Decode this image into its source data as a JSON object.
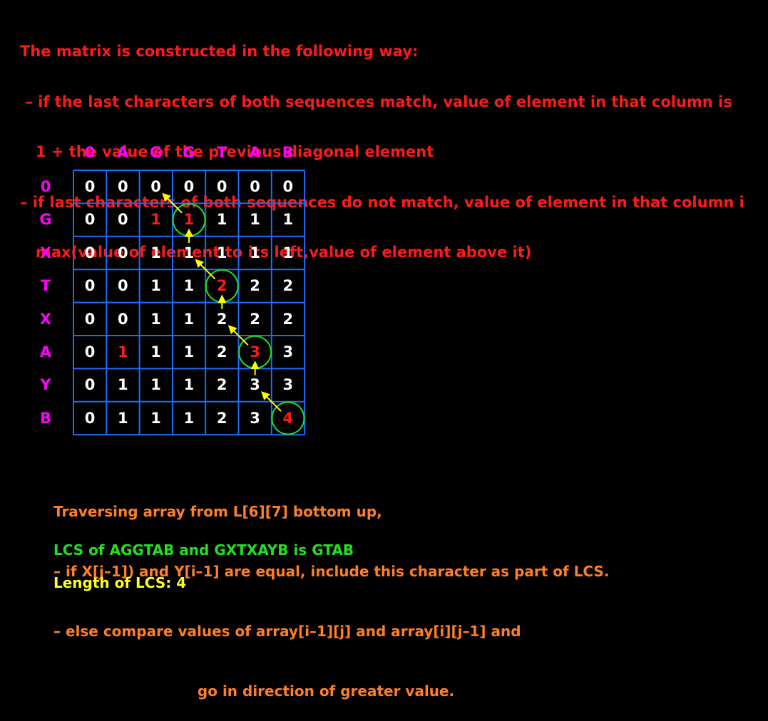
{
  "intro_lines": [
    "The matrix is constructed in the following way:",
    " – if the last characters of both sequences match, value of element in that column is",
    "   1 + the value of the previous diagonal element",
    "– if last characters of both sequences do not match, value of element in that column i",
    "   max(value of element to its left,value of element above it)"
  ],
  "column_headers": [
    "0",
    "A",
    "G",
    "G",
    "T",
    "A",
    "B"
  ],
  "row_headers": [
    "0",
    "G",
    "X",
    "T",
    "X",
    "A",
    "Y",
    "B"
  ],
  "matrix": [
    [
      0,
      0,
      0,
      0,
      0,
      0,
      0
    ],
    [
      0,
      0,
      1,
      1,
      1,
      1,
      1
    ],
    [
      0,
      0,
      1,
      1,
      1,
      1,
      1
    ],
    [
      0,
      0,
      1,
      1,
      2,
      2,
      2
    ],
    [
      0,
      0,
      1,
      1,
      2,
      2,
      2
    ],
    [
      0,
      1,
      1,
      1,
      2,
      3,
      3
    ],
    [
      0,
      1,
      1,
      1,
      2,
      3,
      3
    ],
    [
      0,
      1,
      1,
      1,
      2,
      3,
      4
    ]
  ],
  "highlighted_cells": [
    [
      1,
      2
    ],
    [
      1,
      3
    ],
    [
      3,
      4
    ],
    [
      5,
      1
    ],
    [
      5,
      5
    ],
    [
      7,
      6
    ]
  ],
  "circled_cells": [
    [
      1,
      3
    ],
    [
      3,
      4
    ],
    [
      5,
      5
    ],
    [
      7,
      6
    ]
  ],
  "trace_arrows": [
    {
      "from": [
        1,
        3
      ],
      "to": [
        0,
        2
      ]
    },
    {
      "from": [
        2,
        3
      ],
      "to": [
        1,
        3
      ]
    },
    {
      "from": [
        3,
        4
      ],
      "to": [
        2,
        3
      ]
    },
    {
      "from": [
        4,
        4
      ],
      "to": [
        3,
        4
      ]
    },
    {
      "from": [
        5,
        5
      ],
      "to": [
        4,
        4
      ]
    },
    {
      "from": [
        6,
        5
      ],
      "to": [
        5,
        5
      ]
    },
    {
      "from": [
        7,
        6
      ],
      "to": [
        6,
        5
      ]
    }
  ],
  "colors": {
    "intro": "#ff1a1a",
    "headers": "#ff00ff",
    "grid": "#1e6bff",
    "values": "#ffffff",
    "highlight": "#ff1a1a",
    "circle": "#22dd22",
    "arrow": "#ffff00",
    "explain": "#ff7f27",
    "result": "#22e022",
    "length": "#ffff22"
  },
  "explanation_lines": [
    "Traversing array from L[6][7] bottom up,",
    "– if X[j–1]) and Y[i–1] are equal, include this character as part of LCS.",
    "– else compare values of array[i–1][j] and array[i][j–1] and",
    "                             go in direction of greater value."
  ],
  "result_text": "LCS of AGGTAB and GXTXAYB is GTAB",
  "length_text": "Length of LCS: 4"
}
